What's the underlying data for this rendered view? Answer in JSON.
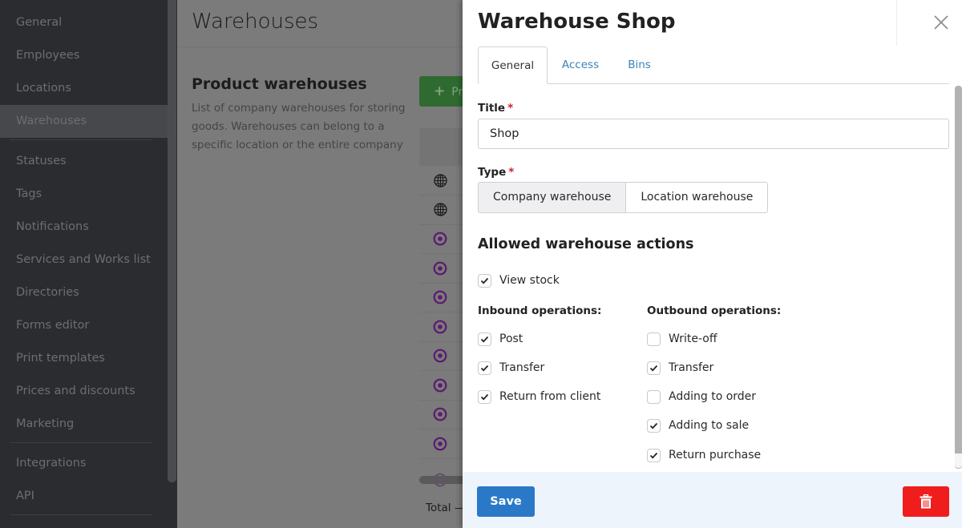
{
  "sidebar": {
    "items": [
      {
        "label": "General"
      },
      {
        "label": "Employees"
      },
      {
        "label": "Locations"
      },
      {
        "label": "Warehouses",
        "active": true
      },
      {
        "label": "Statuses"
      },
      {
        "label": "Tags"
      },
      {
        "label": "Notifications"
      },
      {
        "label": "Services and Works list"
      },
      {
        "label": "Directories"
      },
      {
        "label": "Forms editor"
      },
      {
        "label": "Print templates"
      },
      {
        "label": "Prices and discounts"
      },
      {
        "label": "Marketing"
      },
      {
        "label": "Integrations"
      },
      {
        "label": "API"
      }
    ]
  },
  "main": {
    "title": "Warehouses",
    "section_title": "Product warehouses",
    "section_description": "List of company warehouses for storing goods. Warehouses can belong to a specific location or the entire company",
    "add_button_label": "Pr",
    "add_button_icon": "plus-icon",
    "rows": [
      {
        "icon": "globe-icon"
      },
      {
        "icon": "globe-icon"
      },
      {
        "icon": "location-target-icon"
      },
      {
        "icon": "location-target-icon"
      },
      {
        "icon": "location-target-icon"
      },
      {
        "icon": "location-target-icon"
      },
      {
        "icon": "location-target-icon"
      },
      {
        "icon": "location-target-icon"
      },
      {
        "icon": "location-target-icon"
      },
      {
        "icon": "location-target-icon"
      }
    ],
    "total_label": "Total —"
  },
  "panel": {
    "title": "Warehouse Shop",
    "tabs": [
      {
        "label": "General",
        "active": true
      },
      {
        "label": "Access"
      },
      {
        "label": "Bins"
      }
    ],
    "title_field": {
      "label": "Title",
      "required_mark": "*",
      "value": "Shop"
    },
    "type_field": {
      "label": "Type",
      "required_mark": "*",
      "options": [
        {
          "label": "Company warehouse",
          "selected": true
        },
        {
          "label": "Location warehouse",
          "selected": false
        }
      ]
    },
    "actions_heading": "Allowed warehouse actions",
    "view_stock": {
      "label": "View stock",
      "checked": true
    },
    "inbound": {
      "title": "Inbound operations:",
      "items": [
        {
          "label": "Post",
          "checked": true
        },
        {
          "label": "Transfer",
          "checked": true
        },
        {
          "label": "Return from client",
          "checked": true
        }
      ]
    },
    "outbound": {
      "title": "Outbound operations:",
      "items": [
        {
          "label": "Write-off",
          "checked": false
        },
        {
          "label": "Transfer",
          "checked": true
        },
        {
          "label": "Adding to order",
          "checked": false
        },
        {
          "label": "Adding to sale",
          "checked": true
        },
        {
          "label": "Return purchase",
          "checked": true
        }
      ]
    },
    "save_label": "Save",
    "delete_icon": "trash-icon"
  },
  "colors": {
    "primary": "#2979c7",
    "danger": "#f01d1d",
    "link": "#3a82b9",
    "required": "#d0202a",
    "location_icon": "#5b1a6e"
  }
}
